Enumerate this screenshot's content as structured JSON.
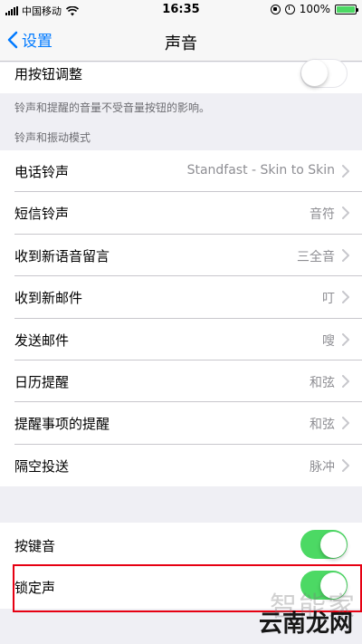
{
  "status_bar": {
    "carrier": "中国移动",
    "time": "16:35",
    "battery": "100%"
  },
  "nav": {
    "back_label": "设置",
    "title": "声音"
  },
  "top_partial_row": {
    "label": "用按钮调整",
    "toggle_on": false
  },
  "volume_note": "铃声和提醒的音量不受音量按钮的影响。",
  "section_header": "铃声和振动模式",
  "sound_rows": [
    {
      "label": "电话铃声",
      "value": "Standfast - Skin to Skin"
    },
    {
      "label": "短信铃声",
      "value": "音符"
    },
    {
      "label": "收到新语音留言",
      "value": "三全音"
    },
    {
      "label": "收到新邮件",
      "value": "叮"
    },
    {
      "label": "发送邮件",
      "value": "嗖"
    },
    {
      "label": "日历提醒",
      "value": "和弦"
    },
    {
      "label": "提醒事项的提醒",
      "value": "和弦"
    },
    {
      "label": "隔空投送",
      "value": "脉冲"
    }
  ],
  "toggle_rows": [
    {
      "label": "按键音",
      "toggle_on": true
    },
    {
      "label": "锁定声",
      "toggle_on": true
    }
  ],
  "watermark": {
    "faint": "智能家",
    "main": "云南龙网"
  },
  "colors": {
    "accent": "#007aff",
    "toggle_on": "#4cd964",
    "highlight": "#e60012"
  }
}
